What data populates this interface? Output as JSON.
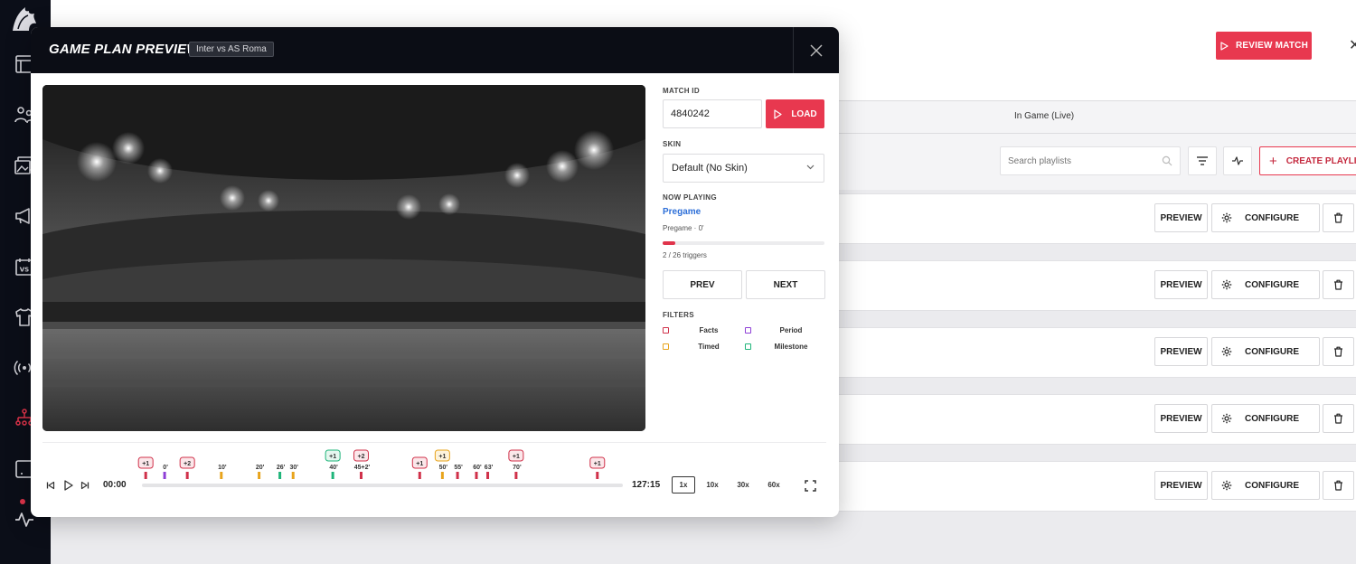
{
  "colors": {
    "accent": "#e8384f",
    "dark": "#0b0d15",
    "link": "#2d6fd8"
  },
  "background": {
    "review_label": "REVIEW MATCH",
    "tab_live": "In Game (Live)",
    "search_placeholder": "Search playlists",
    "create_label": "CREATE PLAYLIST",
    "rows": [
      {
        "preview": "PREVIEW",
        "configure": "CONFIGURE"
      },
      {
        "preview": "PREVIEW",
        "configure": "CONFIGURE"
      },
      {
        "preview": "PREVIEW",
        "configure": "CONFIGURE"
      },
      {
        "preview": "PREVIEW",
        "configure": "CONFIGURE"
      },
      {
        "preview": "PREVIEW",
        "configure": "CONFIGURE"
      }
    ]
  },
  "modal": {
    "title": "GAME PLAN PREVIEW",
    "match_chip": "Inter vs AS Roma",
    "match_id_label": "MATCH ID",
    "match_id_value": "4840242",
    "load_label": "LOAD",
    "skin_label": "SKIN",
    "skin_value": "Default (No Skin)",
    "now_playing_label": "NOW PLAYING",
    "now_playing_title": "Pregame",
    "now_playing_sub": "Pregame · 0'",
    "progress": 0.08,
    "triggers_text": "2 / 26 triggers",
    "prev_label": "PREV",
    "next_label": "NEXT",
    "filters_label": "FILTERS",
    "filters": [
      {
        "label": "Facts",
        "color": "#d0314a"
      },
      {
        "label": "Period",
        "color": "#8e3fd6"
      },
      {
        "label": "Timed",
        "color": "#e8a41c"
      },
      {
        "label": "Milestone",
        "color": "#1fb57a"
      }
    ],
    "time_current": "00:00",
    "time_total": "127:15",
    "speeds": [
      "1x",
      "10x",
      "30x",
      "60x"
    ],
    "active_speed": "1x"
  },
  "timeline": {
    "duration": 127.25,
    "markers": [
      {
        "min": 1,
        "color": "#d0314a",
        "badge": "+1"
      },
      {
        "min": 6,
        "color": "#8e3fd6",
        "label": "0'"
      },
      {
        "min": 12,
        "color": "#d0314a",
        "badge": "+2"
      },
      {
        "min": 21,
        "color": "#e8a41c",
        "label": "10'"
      },
      {
        "min": 31,
        "color": "#e8a41c",
        "label": "20'"
      },
      {
        "min": 36.5,
        "color": "#1fb57a",
        "label": "26'"
      },
      {
        "min": 40,
        "color": "#e8a41c",
        "label": "30'"
      },
      {
        "min": 50.5,
        "color": "#1fb57a",
        "label": "40'",
        "badge": "+1"
      },
      {
        "min": 58,
        "color": "#d0314a",
        "label": "45+2'",
        "badge": "+2"
      },
      {
        "min": 73.5,
        "color": "#d0314a",
        "badge": "+1"
      },
      {
        "min": 79.5,
        "color": "#e8a41c",
        "label": "50'",
        "badge": "+1"
      },
      {
        "min": 83.5,
        "color": "#d0314a",
        "label": "55'"
      },
      {
        "min": 88.5,
        "color": "#d0314a",
        "label": "60'"
      },
      {
        "min": 91.5,
        "color": "#d0314a",
        "label": "63'"
      },
      {
        "min": 99,
        "color": "#d0314a",
        "label": "70'",
        "badge": "+1"
      },
      {
        "min": 120.5,
        "color": "#d0314a",
        "badge": "+1"
      }
    ]
  }
}
